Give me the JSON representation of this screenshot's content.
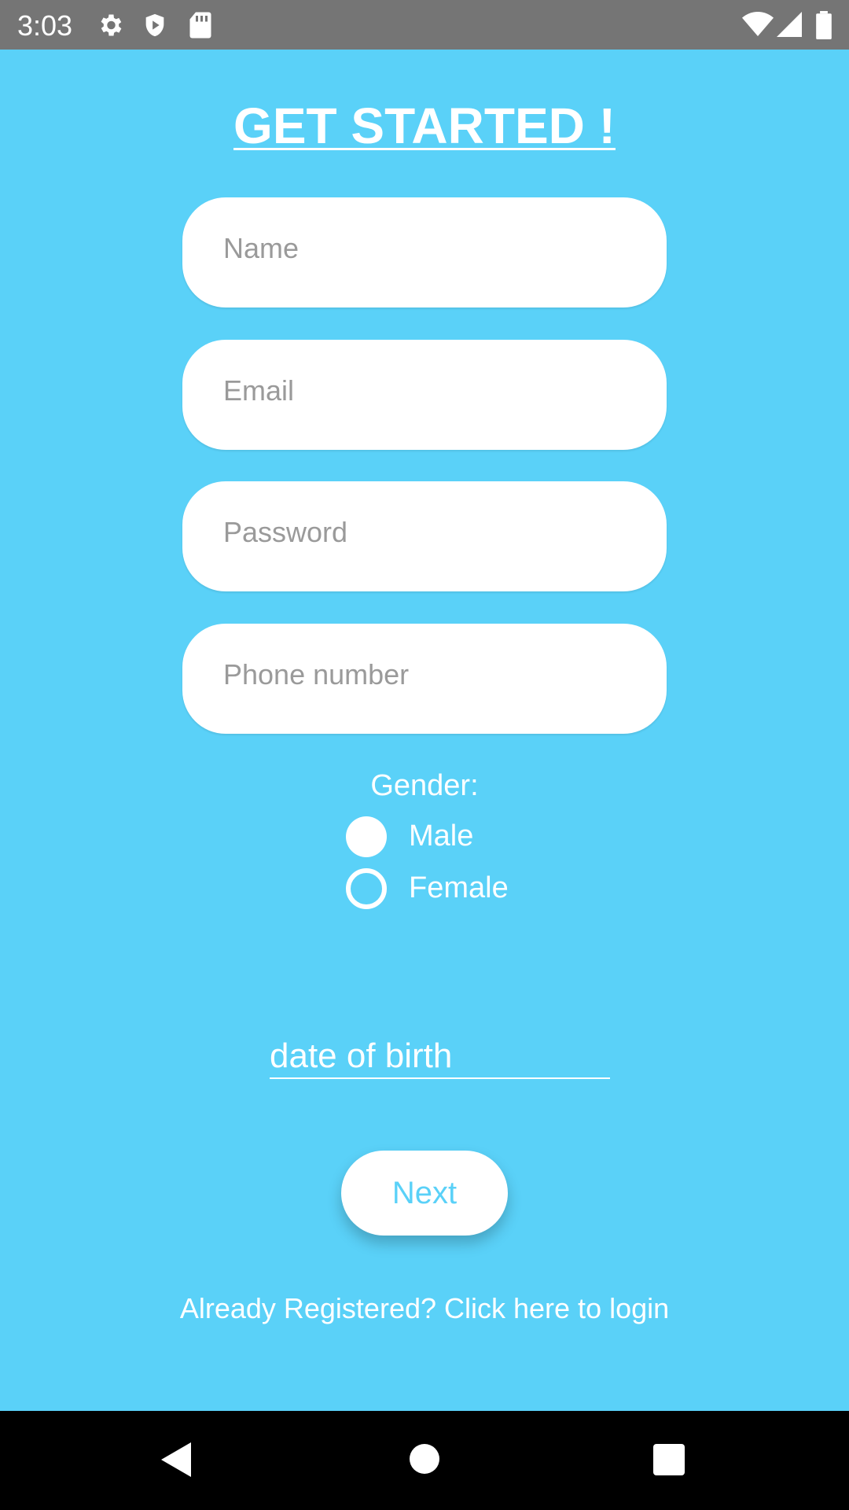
{
  "status_bar": {
    "time": "3:03",
    "icons": [
      "settings-icon",
      "shield-icon",
      "sd-card-icon",
      "wifi-icon",
      "signal-icon",
      "battery-icon"
    ]
  },
  "form": {
    "title": "GET STARTED !",
    "name_placeholder": "Name",
    "email_placeholder": "Email",
    "password_placeholder": "Password",
    "phone_placeholder": "Phone number",
    "gender_label": "Gender:",
    "male_label": "Male",
    "female_label": "Female",
    "male_selected": true,
    "dob_placeholder": "date of birth",
    "next_label": "Next",
    "login_link": "Already Registered? Click here to login"
  },
  "colors": {
    "background": "#5AD1F8",
    "status_bar": "#757575",
    "nav_bar": "#000000",
    "field": "#FFFFFF"
  },
  "nav_bar": {
    "icons": [
      "back-icon",
      "home-icon",
      "recent-apps-icon"
    ]
  }
}
